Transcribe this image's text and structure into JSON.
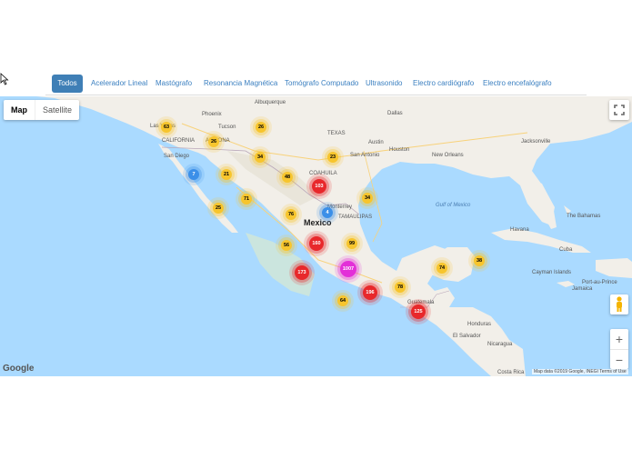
{
  "tabs": [
    {
      "label": "Todos",
      "active": true
    },
    {
      "label": "Acelerador Lineal",
      "active": false
    },
    {
      "label": "Mastógrafo",
      "active": false
    },
    {
      "label": "Resonancia Magnética",
      "active": false
    },
    {
      "label": "Tomógrafo Computado",
      "active": false
    },
    {
      "label": "Ultrasonido",
      "active": false
    },
    {
      "label": "Electro cardiógrafo",
      "active": false
    },
    {
      "label": "Electro encefalógrafo",
      "active": false
    }
  ],
  "map": {
    "map_type_options": [
      "Map",
      "Satellite"
    ],
    "selected_map_type": "Map",
    "zoom_in_label": "+",
    "zoom_out_label": "−",
    "google_logo": "Google",
    "attribution": "Map data ©2019 Google, INEGI   Terms of Use",
    "places": {
      "mexico": "Mexico",
      "las_vegas": "Las Vegas",
      "san_diego": "San Diego",
      "phoenix": "Phoenix",
      "tucson": "Tucson",
      "albuquerque": "Albuquerque",
      "dallas": "Dallas",
      "austin": "Austin",
      "houston": "Houston",
      "san_antonio": "San Antonio",
      "new_orleans": "New Orleans",
      "jacksonville": "Jacksonville",
      "monterrey": "Monterrey",
      "gulf": "Gulf of Mexico",
      "cuba": "Cuba",
      "havana": "Havana",
      "the_bahamas": "The Bahamas",
      "jamaica": "Jamaica",
      "guatemala": "Guatemala",
      "honduras": "Honduras",
      "nicaragua": "Nicaragua",
      "el_salvador": "El Salvador",
      "costa_rica": "Costa Rica",
      "cayman": "Cayman Islands",
      "port_au_prince": "Port-au-Prince",
      "california": "CALIFORNIA",
      "arizona": "ARIZONA",
      "texas": "TEXAS",
      "coahuila": "COAHUILA",
      "tamaulipas": "TAMAULIPAS"
    },
    "clusters": [
      {
        "count": "63",
        "level": "yellow"
      },
      {
        "count": "26",
        "level": "yellow"
      },
      {
        "count": "26",
        "level": "yellow"
      },
      {
        "count": "34",
        "level": "yellow"
      },
      {
        "count": "23",
        "level": "yellow"
      },
      {
        "count": "7",
        "level": "blue"
      },
      {
        "count": "21",
        "level": "yellow"
      },
      {
        "count": "48",
        "level": "yellow"
      },
      {
        "count": "103",
        "level": "red"
      },
      {
        "count": "71",
        "level": "yellow"
      },
      {
        "count": "25",
        "level": "yellow"
      },
      {
        "count": "76",
        "level": "yellow"
      },
      {
        "count": "4",
        "level": "blue"
      },
      {
        "count": "34",
        "level": "yellow"
      },
      {
        "count": "56",
        "level": "yellow"
      },
      {
        "count": "160",
        "level": "red"
      },
      {
        "count": "99",
        "level": "yellow"
      },
      {
        "count": "1007",
        "level": "magenta"
      },
      {
        "count": "173",
        "level": "red"
      },
      {
        "count": "74",
        "level": "yellow"
      },
      {
        "count": "38",
        "level": "yellow"
      },
      {
        "count": "78",
        "level": "yellow"
      },
      {
        "count": "64",
        "level": "yellow"
      },
      {
        "count": "196",
        "level": "red"
      },
      {
        "count": "125",
        "level": "red"
      }
    ]
  },
  "colors": {
    "active_tab": "#3f7fb6",
    "tab_text": "#3a7fc0",
    "water": "#aadaff",
    "land": "#f2efe9",
    "cluster_yellow": "#f7c52d",
    "cluster_red": "#e8282b",
    "cluster_magenta": "#e32fd8",
    "cluster_blue": "#3b8fe8"
  }
}
